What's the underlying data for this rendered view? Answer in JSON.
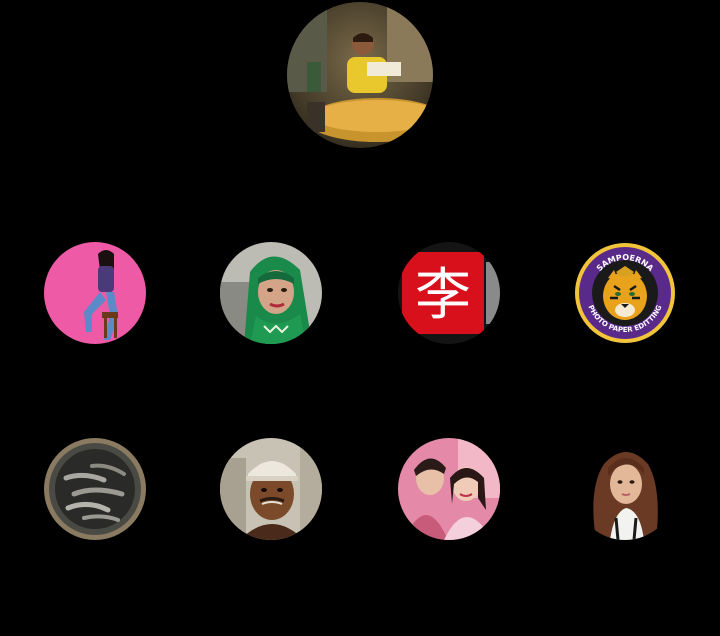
{
  "featured": {
    "subject": "man-reading-book-photo"
  },
  "row1": [
    {
      "subject": "woman-posing-on-stool-photo"
    },
    {
      "subject": "woman-green-headscarf-photo"
    },
    {
      "subject": "red-character-sign-photo",
      "sign_glyph": "李"
    },
    {
      "subject": "sampoerna-tiger-seal",
      "seal_top": "SAMPOERNA",
      "seal_bottom": "PHOTO PAPER EDITTING"
    }
  ],
  "row2": [
    {
      "subject": "bucket-of-fish-photo"
    },
    {
      "subject": "man-white-cap-photo"
    },
    {
      "subject": "couple-portrait-photo"
    },
    {
      "subject": "woman-long-hair-photo"
    }
  ],
  "colors": {
    "background": "#000000",
    "pink_backdrop": "#ee5aa6",
    "sign_red": "#d8101c",
    "seal_orange": "#e8a21c",
    "seal_purple": "#5a2a8a"
  }
}
